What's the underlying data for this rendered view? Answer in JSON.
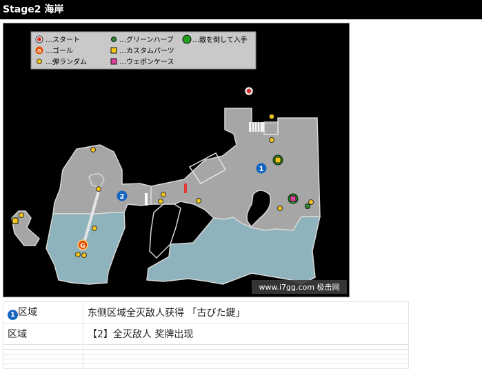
{
  "page": {
    "title": "Stage2 海岸"
  },
  "map": {
    "watermark": "www.i7gg.com 极击网",
    "legend": [
      {
        "icon": "start-icon",
        "label": "…スタート"
      },
      {
        "icon": "green-herb-icon",
        "label": "…グリーンハーブ"
      },
      {
        "icon": "enemy-drop-icon",
        "label": "…敵を倒して入手"
      },
      {
        "icon": "goal-icon",
        "label": "…ゴール"
      },
      {
        "icon": "custom-parts-icon",
        "label": "…カスタムパーツ"
      },
      {
        "icon": "ammo-random-icon",
        "label": "…弾ランダム"
      },
      {
        "icon": "weapon-case-icon",
        "label": "…ウェポンケース"
      }
    ],
    "markers": {
      "area1": "1",
      "area2": "2",
      "goal": "G"
    },
    "colors": {
      "land": "#a6a6a6",
      "water": "#8fb3bc",
      "ammo": "#f5c518",
      "herb": "#2e8b2e",
      "start": "#d32f2f",
      "goal": "#e65100",
      "area_marker": "#1565c0",
      "custom_parts": "#f5c518",
      "weapon_case": "#e040a0"
    }
  },
  "table": {
    "rows": [
      {
        "badge": "1",
        "area": "区域",
        "detail": "东侧区域全灭敌人获得 「古びた鍵」"
      },
      {
        "badge": "",
        "area": "区域",
        "detail": "【2】全灭敌人 奖牌出现"
      }
    ]
  }
}
